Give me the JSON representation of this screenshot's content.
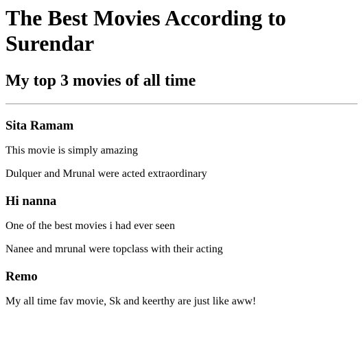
{
  "page": {
    "title": "The Best Movies According to Surendar",
    "subtitle": "My top 3 movies of all time"
  },
  "movies": [
    {
      "name": "Sita Ramam",
      "lines": [
        "This movie is simply amazing",
        "Dulquer and Mrunal were acted extraordinary"
      ]
    },
    {
      "name": "Hi nanna",
      "lines": [
        "One of the best movies i had ever seen",
        "Nanee and mrunal were topclass with their acting"
      ]
    },
    {
      "name": "Remo",
      "lines": [
        "My all time fav movie, Sk and keerthy are just like aww!"
      ]
    }
  ]
}
